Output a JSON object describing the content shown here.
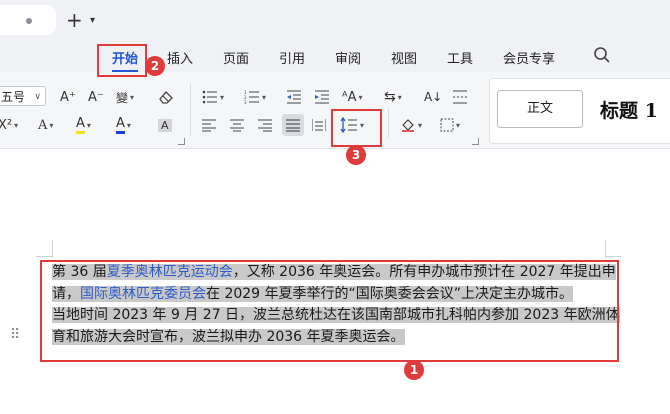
{
  "tabs": {
    "new_tab_label": "+",
    "new_tab_chevron": "⌄"
  },
  "menu": {
    "items": [
      {
        "label": "开始",
        "active": true
      },
      {
        "label": "插入"
      },
      {
        "label": "页面"
      },
      {
        "label": "引用"
      },
      {
        "label": "审阅"
      },
      {
        "label": "视图"
      },
      {
        "label": "工具"
      },
      {
        "label": "会员专享"
      }
    ],
    "search_icon": "search-icon"
  },
  "toolbar": {
    "font_size": "五号",
    "grow_font": "A⁺",
    "shrink_font": "A⁻",
    "phonetic": "wén",
    "superscript": "X²",
    "text_effect": "A",
    "highlight": "A",
    "font_color": "A",
    "char_shading": "A",
    "style_normal": "正文",
    "style_heading": "标题 1"
  },
  "document": {
    "lines": [
      [
        {
          "text": "第 36 届",
          "link": false
        },
        {
          "text": "夏季奥林匹克运动会",
          "link": true
        },
        {
          "text": "，又称 2036 年奥运会。所有申办城市预计在 2027 年提出申",
          "link": false
        }
      ],
      [
        {
          "text": "请，",
          "link": false
        },
        {
          "text": "国际奥林匹克委员会",
          "link": true
        },
        {
          "text": "在 2029 年夏季举行的“国际奥委会会议”上决定主办城市。",
          "link": false
        }
      ],
      [
        {
          "text": "当地时间 2023 年 9 月 27 日，波兰总统杜达在该国南部城市扎科帕内参加 2023 年欧洲体",
          "link": false
        }
      ],
      [
        {
          "text": "育和旅游大会时宣布，波兰拟申办 2036 年夏季奥运会。",
          "link": false
        }
      ]
    ],
    "drag_handle": "⠿"
  },
  "annotations": {
    "badges": [
      "1",
      "2",
      "3"
    ],
    "color": "#e03b3b"
  },
  "colors": {
    "accent": "#1f57d6",
    "link": "#2b5cc7",
    "selection": "#c9c9c9",
    "annotation": "#e03b3b"
  }
}
